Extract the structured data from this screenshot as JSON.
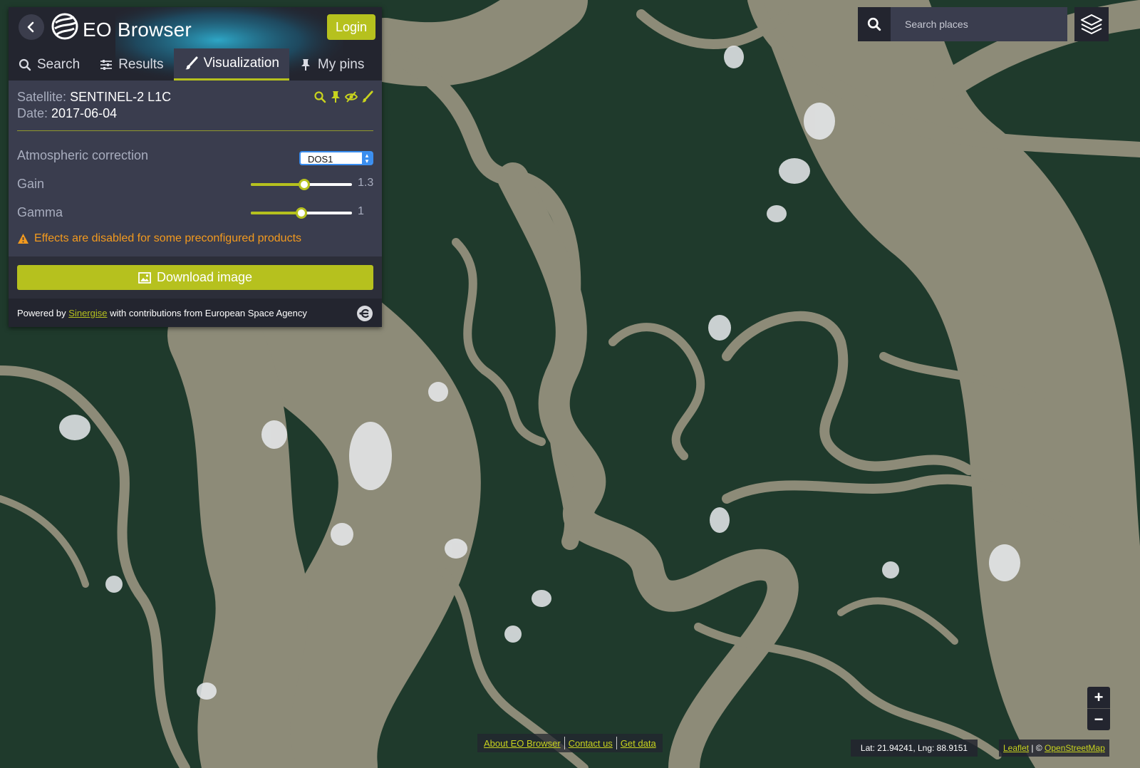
{
  "app": {
    "title": "EO Browser",
    "login_label": "Login"
  },
  "tabs": [
    {
      "label": "Search",
      "icon": "search-icon",
      "active": false
    },
    {
      "label": "Results",
      "icon": "sliders-icon",
      "active": false
    },
    {
      "label": "Visualization",
      "icon": "brush-icon",
      "active": true
    },
    {
      "label": "My pins",
      "icon": "pin-icon",
      "active": false
    }
  ],
  "product": {
    "satellite_label": "Satellite:",
    "satellite_value": "SENTINEL-2 L1C",
    "date_label": "Date:",
    "date_value": "2017-06-04",
    "icons": [
      "zoom-icon",
      "pin-icon",
      "visibility-off-icon",
      "brush-icon"
    ]
  },
  "settings": {
    "atmospheric_label": "Atmospheric correction",
    "atmospheric_value": "DOS1",
    "gain_label": "Gain",
    "gain_value": "1.3",
    "gain_fraction": 0.53,
    "gamma_label": "Gamma",
    "gamma_value": "1",
    "gamma_fraction": 0.5
  },
  "warning": {
    "text": "Effects are disabled for some preconfigured products",
    "icon": "warning-icon"
  },
  "download": {
    "label": "Download image",
    "icon": "image-icon"
  },
  "footer": {
    "prefix": "Powered by",
    "link": "Sinergise",
    "suffix": "with contributions from European Space Agency"
  },
  "search": {
    "placeholder": "Search places"
  },
  "zoom": {
    "in_label": "+",
    "out_label": "−"
  },
  "bottom_links": [
    "About EO Browser",
    "Contact us",
    "Get data"
  ],
  "coords": "Lat: 21.94241, Lng: 88.9151",
  "attribution": {
    "leaflet": "Leaflet",
    "sep": "|",
    "copyright": "©",
    "osm": "OpenStreetMap"
  },
  "colors": {
    "accent": "#b6c11e",
    "panel_bg": "#3a3d4e",
    "panel_dark": "#23252f",
    "warning": "#f39a1e",
    "water": "#8d8b78",
    "forest": "#1f3a2c"
  }
}
